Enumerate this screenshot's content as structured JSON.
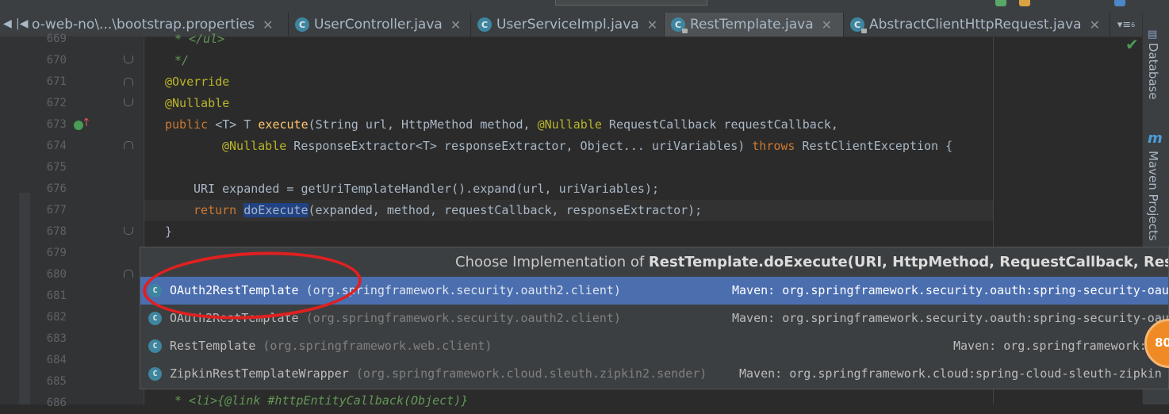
{
  "tabs": [
    {
      "label": "o-web-no\\...\\bootstrap.properties",
      "type": "file",
      "active": false
    },
    {
      "label": "UserController.java",
      "type": "class",
      "active": false
    },
    {
      "label": "UserServiceImpl.java",
      "type": "class",
      "active": false
    },
    {
      "label": "RestTemplate.java",
      "type": "class-locked",
      "active": true
    },
    {
      "label": "AbstractClientHttpRequest.java",
      "type": "class-locked",
      "active": false
    }
  ],
  "tab_overflow": "▾≡",
  "tab_overflow_count": "6",
  "code": {
    "line_numbers": [
      "669",
      "670",
      "671",
      "672",
      "673",
      "674",
      "675",
      "676",
      "677",
      "678",
      "679",
      "680",
      "681",
      "682",
      "683",
      "684",
      "685",
      "686"
    ],
    "l669": "* </ul>",
    "l670": "*/",
    "l671": "@Override",
    "l672": "@Nullable",
    "l673": {
      "public": "public",
      "generic": "<T> T",
      "name": "execute",
      "params_a": "(String url, HttpMethod method, ",
      "anno": "@Nullable",
      "params_b": " RequestCallback requestCallback,"
    },
    "l674": {
      "anno": "@Nullable",
      "a": " ResponseExtractor<T> responseExtractor, Object... uriVariables) ",
      "throws": "throws",
      "b": " RestClientException {"
    },
    "l676": "URI expanded = getUriTemplateHandler().expand(url, uriVariables);",
    "l677": {
      "return": "return",
      "call": "doExecute",
      "args": "(expanded, method, requestCallback, responseExtractor);"
    },
    "l678": "}",
    "l686": "* <li>{@link #httpEntityCallback(Object)}"
  },
  "popup": {
    "title_prefix": "Choose Implementation of ",
    "title_method": "RestTemplate.doExecute(URI, HttpMethod, RequestCallback, ResponseExt",
    "items": [
      {
        "name": "OAuth2RestTemplate",
        "pkg": "(org.springframework.security.oauth2.client)",
        "source": "Maven: org.springframework.security.oauth:spring-security-oau",
        "selected": true
      },
      {
        "name": "OAuth2RestTemplate",
        "pkg": "(org.springframework.security.oauth2.client)",
        "source": "Maven: org.springframework.security.oauth:spring-security-oau",
        "selected": false
      },
      {
        "name": "RestTemplate",
        "pkg": "(org.springframework.web.client)",
        "source": "Maven: org.springframework:",
        "selected": false
      },
      {
        "name": "ZipkinRestTemplateWrapper",
        "pkg": "(org.springframework.cloud.sleuth.zipkin2.sender)",
        "source": "Maven: org.springframework.cloud:spring-cloud-sleuth-zipkin",
        "selected": false
      }
    ]
  },
  "right_panel": {
    "database_label": "Database",
    "maven_icon": "m",
    "maven_label": "Maven Projects"
  },
  "badge_text": "80",
  "icons": {
    "class_icon": "C",
    "check": "✔",
    "gutter_override": "↑"
  },
  "colors": {
    "editor_bg": "#2b2b2b",
    "keyword": "#cc7832",
    "annotation": "#bbb529",
    "method": "#ffc66d",
    "selection": "#4b6eaf",
    "highlight_circle": "#e02020",
    "badge": "#f08a24"
  }
}
